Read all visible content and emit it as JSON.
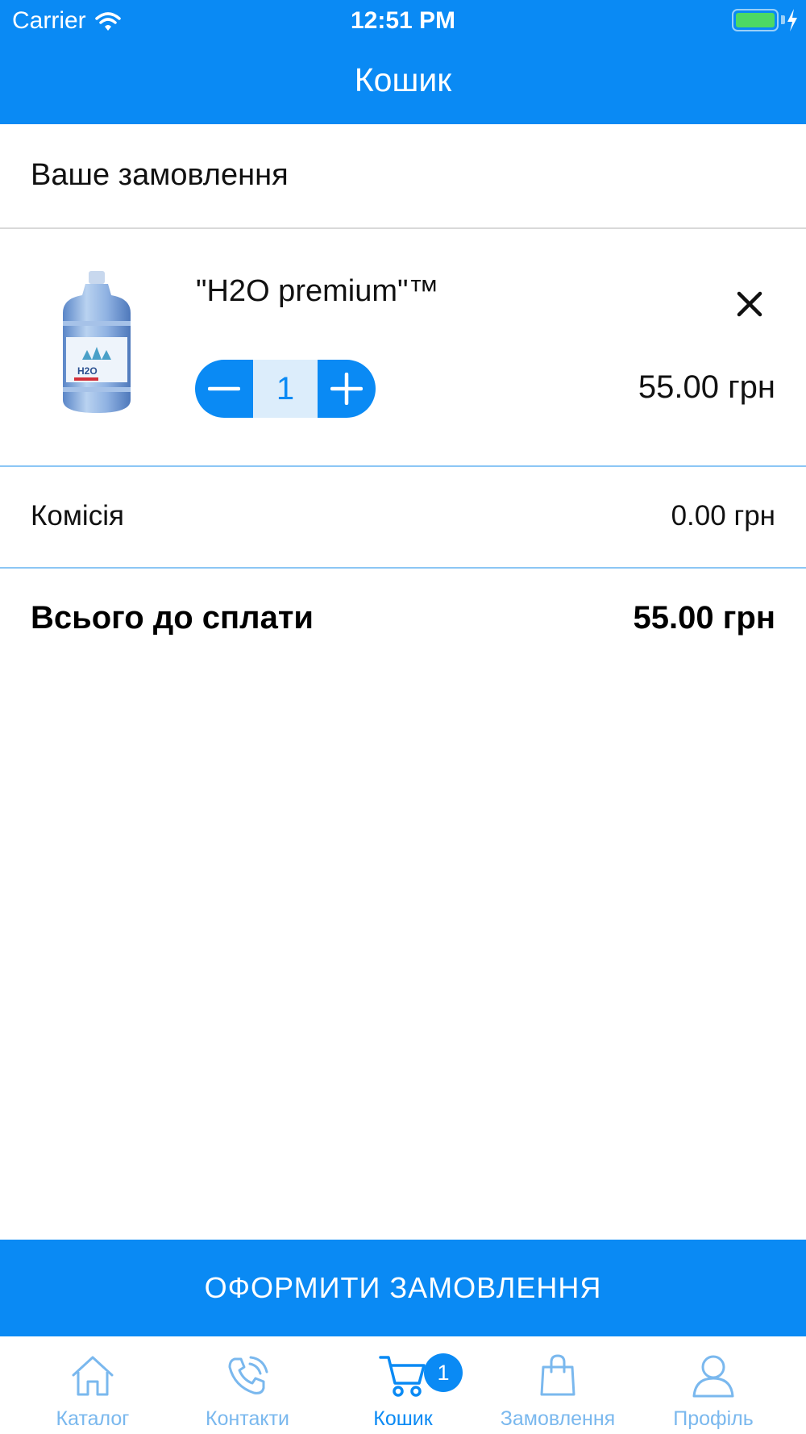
{
  "status_bar": {
    "carrier": "Carrier",
    "time": "12:51 PM"
  },
  "nav": {
    "title": "Кошик"
  },
  "section_title": "Ваше замовлення",
  "cart_item": {
    "name": "\"H2O premium\"™",
    "quantity": "1",
    "price": "55.00 грн",
    "image_label": "H2O"
  },
  "fee": {
    "label": "Комісія",
    "value": "0.00 грн"
  },
  "total": {
    "label": "Всього до сплати",
    "value": "55.00 грн"
  },
  "checkout_label": "ОФОРМИТИ ЗАМОВЛЕННЯ",
  "tabs": [
    {
      "label": "Каталог",
      "icon": "home-icon"
    },
    {
      "label": "Контакти",
      "icon": "phone-icon"
    },
    {
      "label": "Кошик",
      "icon": "cart-icon",
      "active": true
    },
    {
      "label": "Замовлення",
      "icon": "shopping-bag-icon"
    },
    {
      "label": "Профіль",
      "icon": "user-icon"
    }
  ],
  "cart_badge": "1",
  "colors": {
    "primary": "#0a8af4",
    "tab_inactive": "#7ab8ee",
    "qty_bg": "#dcedfb",
    "divider_blue": "#8cc6f5"
  }
}
